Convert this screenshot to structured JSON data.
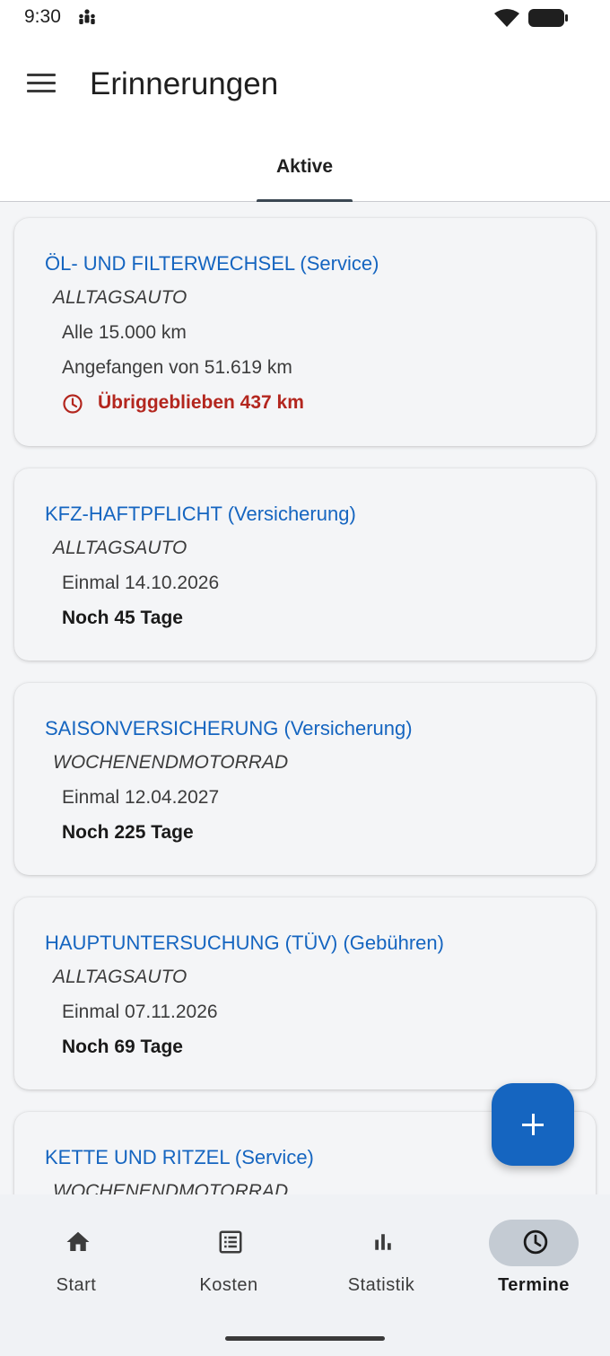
{
  "status_bar": {
    "time": "9:30"
  },
  "app_bar": {
    "title": "Erinnerungen"
  },
  "tabs": [
    {
      "label": "Aktive",
      "active": true
    }
  ],
  "reminders": [
    {
      "title": "ÖL- UND FILTERWECHSEL (Service)",
      "vehicle": "ALLTAGSAUTO",
      "line1": "Alle 15.000 km",
      "line2": "Angefangen von 51.619 km",
      "warning": "Übriggeblieben 437 km"
    },
    {
      "title": "KFZ-HAFTPFLICHT (Versicherung)",
      "vehicle": "ALLTAGSAUTO",
      "line1": "Einmal 14.10.2026",
      "line2": "Noch 45 Tage"
    },
    {
      "title": "SAISONVERSICHERUNG (Versicherung)",
      "vehicle": "WOCHENENDMOTORRAD",
      "line1": "Einmal 12.04.2027",
      "line2": "Noch 225 Tage"
    },
    {
      "title": "HAUPTUNTERSUCHUNG (TÜV) (Gebühren)",
      "vehicle": "ALLTAGSAUTO",
      "line1": "Einmal 07.11.2026",
      "line2": "Noch 69 Tage"
    },
    {
      "title": "KETTE UND RITZEL (Service)",
      "vehicle": "WOCHENENDMOTORRAD"
    }
  ],
  "fab": {
    "icon": "plus-icon"
  },
  "bottom_nav": [
    {
      "label": "Start",
      "icon": "home-icon"
    },
    {
      "label": "Kosten",
      "icon": "list-icon"
    },
    {
      "label": "Statistik",
      "icon": "bar-chart-icon"
    },
    {
      "label": "Termine",
      "icon": "clock-icon",
      "active": true
    }
  ],
  "colors": {
    "accent": "#1565c0",
    "warning": "#b3261e",
    "background": "#f4f5f7",
    "active_nav_pill": "#c4cbd3"
  }
}
